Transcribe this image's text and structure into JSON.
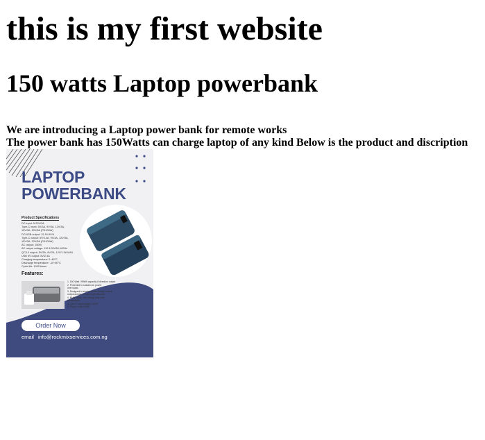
{
  "page": {
    "heading": "this is my first website",
    "subheading": "150 watts Laptop powerbank",
    "intro_lines": [
      "We are introducing a Laptop power bank for remote works",
      "The power bank has 150Watts can charge laptop of any kind Below is the product and discription"
    ]
  },
  "poster": {
    "title_line1": "LAPTOP",
    "title_line2": "POWERBANK",
    "spec_heading": "Product Specifications",
    "specs": [
      "DC input: 5-20V/3A",
      "Type-C input: 5V/3A, 9V/3A, 12V/3A,",
      "15V/3A, 20V/5A (PD100W)",
      "DC/USB output: 12-16.8V/A",
      "Type-C output: 5V/3.4A, 9V/3A, 12V/3A,",
      "15V/3A, 20V/5A (PD100W)",
      "AC output: 150W",
      "AC output voltage: 110-120V/60-100Hz",
      "QC3.0 output: 5V/3A, 9V/2A, 12V/1.5A MAX",
      "USB 5V output: 5V/2.4A",
      "Charging temperature: 0~45°C",
      "Discharge temperature: -10~60°C",
      "Cycle life: 1000 times"
    ],
    "features_heading": "Features:",
    "features": [
      "1. 150 Watt / 99Wh capacity 8 direction output",
      "2. Protected to sustain AC power",
      "over loads",
      "3. Designed to sustain a fast charge output",
      "output across all rated high demand",
      "4. Multi safety, fast energy only safe",
      "temperature",
      "5. Type-C input/output: 100W",
      "6. Plug-in cells 100W"
    ],
    "order_label": "Order Now",
    "email_label": "email",
    "email_value": "info@rockmixservices.com.ng",
    "colors": {
      "brand": "#3c4b86",
      "wave": "#3f4b7e",
      "background": "#f1f1f3",
      "device": "#2c4a63"
    }
  }
}
